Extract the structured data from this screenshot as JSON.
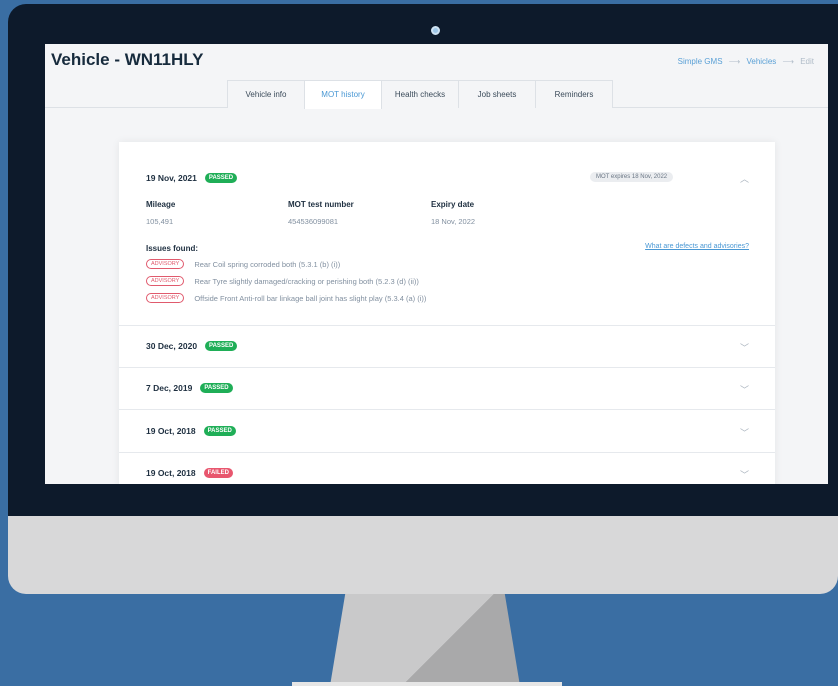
{
  "page_title": "Vehicle - WN11HLY",
  "breadcrumb": [
    "Simple GMS",
    "Vehicles",
    "Edit"
  ],
  "tabs": [
    {
      "label": "Vehicle info"
    },
    {
      "label": "MOT history",
      "active": true
    },
    {
      "label": "Health checks"
    },
    {
      "label": "Job sheets"
    },
    {
      "label": "Reminders"
    }
  ],
  "mot": {
    "expanded": {
      "date": "19 Nov, 2021",
      "status": "PASSED",
      "expiry_pill": "MOT expires 18 Nov, 2022",
      "mileage_label": "Mileage",
      "mileage": "105,491",
      "test_number_label": "MOT test number",
      "test_number": "454536099081",
      "expiry_label": "Expiry date",
      "expiry": "18 Nov, 2022",
      "issues_label": "Issues found:",
      "defects_link": "What are defects and advisories?",
      "issues": [
        {
          "type": "ADVISORY",
          "text": "Rear Coil spring corroded both (5.3.1 (b) (i))"
        },
        {
          "type": "ADVISORY",
          "text": "Rear Tyre slightly damaged/cracking or perishing both (5.2.3 (d) (ii))"
        },
        {
          "type": "ADVISORY",
          "text": "Offside Front Anti-roll bar linkage ball joint has slight play (5.3.4 (a) (i))"
        }
      ]
    },
    "history": [
      {
        "date": "30 Dec, 2020",
        "status": "PASSED"
      },
      {
        "date": "7 Dec, 2019",
        "status": "PASSED"
      },
      {
        "date": "19 Oct, 2018",
        "status": "PASSED"
      },
      {
        "date": "19 Oct, 2018",
        "status": "FAILED"
      }
    ]
  },
  "colors": {
    "background": "#3a6ea3",
    "passed": "#1fae57",
    "failed": "#e8566e",
    "accent": "#4a98d4"
  }
}
